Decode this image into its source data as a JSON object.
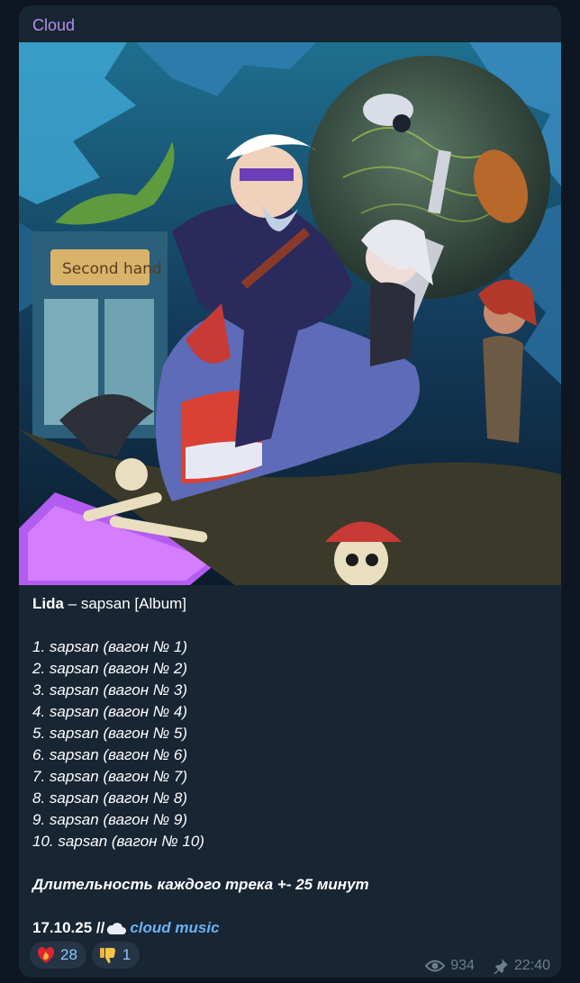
{
  "post": {
    "channel_name": "Cloud",
    "artist": "Lida",
    "title_rest": " – sapsan [Album]",
    "tracks": [
      "1. sapsan (вагон № 1)",
      "2. sapsan (вагон № 2)",
      "3. sapsan (вагон № 3)",
      "4. sapsan (вагон № 4)",
      "5. sapsan (вагон № 5)",
      "6. sapsan (вагон № 6)",
      "7. sapsan (вагон № 7)",
      "8. sapsan (вагон № 8)",
      "9. sapsan (вагон № 9)",
      "10. sapsan (вагон № 10)"
    ],
    "duration_note": "Длительность каждого трека +- 25 минут",
    "date": "17.10.25 //",
    "link_label": "cloud music",
    "image_lettering": "Second hand"
  },
  "reactions": [
    {
      "icon": "heart-on-fire-icon",
      "count": "28"
    },
    {
      "icon": "thumbs-down-icon",
      "count": "1"
    }
  ],
  "meta": {
    "views": "934",
    "time": "22:40"
  },
  "colors": {
    "background": "#0e1621",
    "bubble": "#182533",
    "channel_name": "#b58dec",
    "link": "#6ab3f3",
    "reaction_bg": "#253545",
    "meta": "#6d7f8f"
  }
}
